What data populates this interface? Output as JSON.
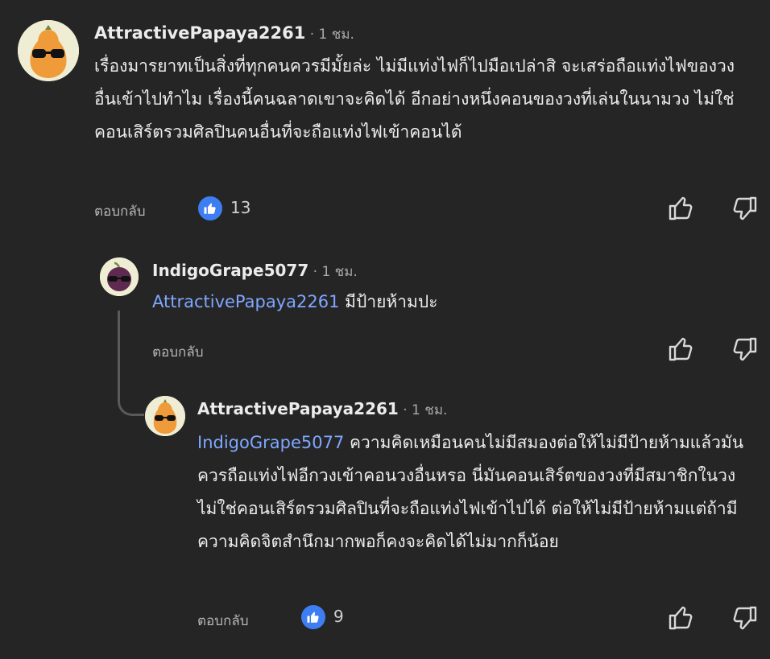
{
  "comments": [
    {
      "author": "AttractivePapaya2261",
      "time": " · 1 ชม.",
      "mention": "",
      "text": "เรื่องมารยาทเป็นสิ่งที่ทุกคนควรมีมั้ยล่ะ ไม่มีแท่งไฟก็ไปมือเปล่าสิ จะเสร่อถือแท่งไฟของวงอื่นเข้าไปทำไม เรื่องนี้คนฉลาดเขาจะคิดได้ อีกอย่างหนึ่งคอนของวงที่เล่นในนามวง ไม่ใช่คอนเสิร์ตรวมศิลปินคนอื่นที่จะถือแท่งไฟเข้าคอนได้",
      "reply_label": "ตอบกลับ",
      "likes": "13",
      "avatar": "papaya-sunglasses-avatar"
    },
    {
      "author": "IndigoGrape5077",
      "time": " · 1 ชม.",
      "mention": "AttractivePapaya2261",
      "text": " มีป้ายห้ามปะ",
      "reply_label": "ตอบกลับ",
      "likes": "",
      "avatar": "grape-sunglasses-avatar"
    },
    {
      "author": "AttractivePapaya2261",
      "time": " · 1 ชม.",
      "mention": "IndigoGrape5077",
      "text": " ความคิดเหมือนคนไม่มีสมองต่อให้ไม่มีป้ายห้ามแล้วมันควรถือแท่งไฟอีกวงเข้าคอนวงอื่นหรอ นี่มันคอนเสิร์ตของวงที่มีสมาชิกในวง ไม่ใช่คอนเสิร์ตรวมศิลปินที่จะถือแท่งไฟเข้าไปได้ ต่อให้ไม่มีป้ายห้ามแต่ถ้ามีความคิดจิตสำนึกมากพอก็คงจะคิดได้ไม่มากก็น้อย",
      "reply_label": "ตอบกลับ",
      "likes": "9",
      "avatar": "papaya-sunglasses-avatar"
    }
  ],
  "colors": {
    "background": "#252526",
    "mention": "#7fa7ff",
    "like_badge": "#3e7ef3"
  },
  "icons": [
    "thumbs-up-icon",
    "thumbs-down-icon",
    "like-badge-icon"
  ]
}
